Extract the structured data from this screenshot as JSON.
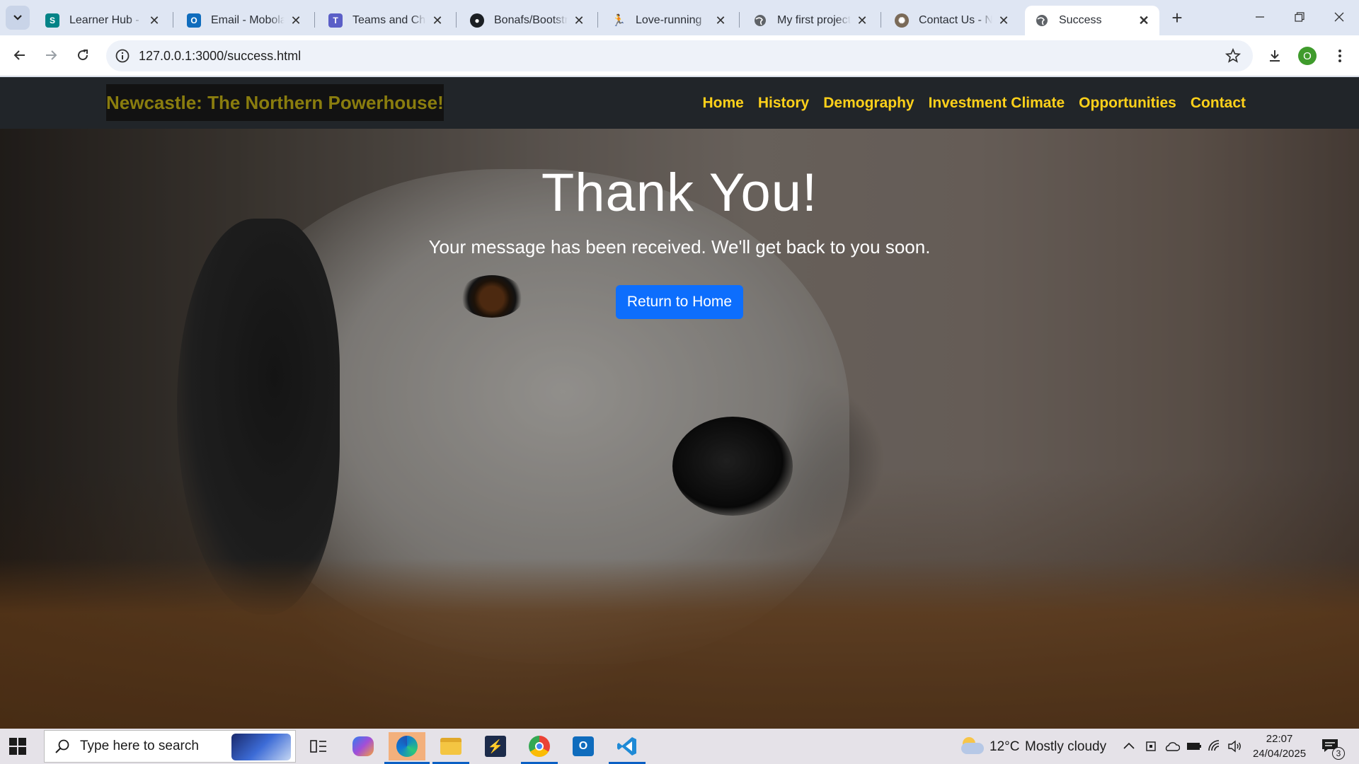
{
  "browser": {
    "tabs": [
      {
        "title": "Learner Hub - Home",
        "icon": "sharepoint-icon",
        "color": "#038387",
        "active": false
      },
      {
        "title": "Email - Mobolaji",
        "icon": "outlook-icon",
        "color": "#0f6cbd",
        "active": false
      },
      {
        "title": "Teams and Channels",
        "icon": "teams-icon",
        "color": "#5b5fc7",
        "active": false
      },
      {
        "title": "Bonafs/Bootstrap",
        "icon": "github-icon",
        "color": "#1b1f23",
        "active": false
      },
      {
        "title": "Love-running",
        "icon": "runner-icon",
        "color": "#d8a200",
        "active": false
      },
      {
        "title": "My first project",
        "icon": "globe-icon",
        "color": "#5f6368",
        "active": false
      },
      {
        "title": "Contact Us - New",
        "icon": "seal-icon",
        "color": "#7a6a58",
        "active": false
      },
      {
        "title": "Success",
        "icon": "globe-icon",
        "color": "#5f6368",
        "active": true
      }
    ],
    "url": "127.0.0.1:3000/success.html",
    "profile_initial": "O"
  },
  "site": {
    "brand": "Newcastle: The Northern Powerhouse!",
    "nav": [
      "Home",
      "History",
      "Demography",
      "Investment Climate",
      "Opportunities",
      "Contact"
    ],
    "hero": {
      "title": "Thank You!",
      "subtitle": "Your message has been received. We'll get back to you soon.",
      "button": "Return to Home"
    },
    "colors": {
      "nav_bg": "#212529",
      "link": "#ffd11a",
      "button": "#0d6efd"
    }
  },
  "taskbar": {
    "search_placeholder": "Type here to search",
    "weather_temp": "12°C",
    "weather_text": "Mostly cloudy",
    "time": "22:07",
    "date": "24/04/2025",
    "notification_count": "3"
  }
}
